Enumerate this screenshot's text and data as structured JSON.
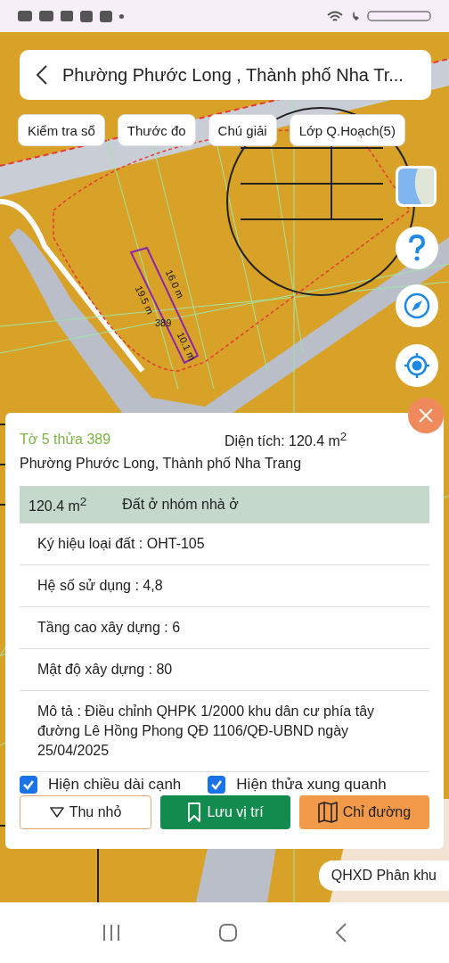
{
  "header": {
    "title": "Phường Phước Long , Thành phố Nha Tr..."
  },
  "chips": [
    "Kiểm tra sổ",
    "Thước đo",
    "Chú giải",
    "Lớp Q.Hoạch(5)"
  ],
  "map": {
    "plot": {
      "edges": [
        "16.0 m",
        "19.5 m",
        "10.1 m"
      ],
      "number": "389"
    },
    "layer_label": "QHXD Phân khu"
  },
  "parcel": {
    "title": "Tờ 5 thửa 389",
    "area": "Diện tích: 120.4 m$^{2}$",
    "address": "Phường Phước Long, Thành phố Nha Trang",
    "summary": {
      "area": "120.4 m$^{2}$",
      "land_use": "Đất ở nhóm nhà ở"
    },
    "rows": [
      "Ký hiệu loại đất : OHT-105",
      "Hệ số sử dụng : 4,8",
      "Tầng cao xây dựng : 6",
      "Mật độ xây dựng : 80",
      "Mô tả : Điều chỉnh QHPK 1/2000 khu dân cư phía tây đường Lê Hồng Phong QĐ 1106/QĐ-UBND ngày 25/04/2025"
    ],
    "options": [
      {
        "label": "Hiện chiều dài cạnh",
        "checked": true
      },
      {
        "label": "Hiện thửa xung quanh",
        "checked": true
      }
    ],
    "buttons": [
      {
        "kind": "collapse",
        "label": "Thu nhỏ"
      },
      {
        "kind": "save",
        "label": "Lưu vị trí"
      },
      {
        "kind": "directions",
        "label": "Chỉ đường"
      }
    ]
  }
}
